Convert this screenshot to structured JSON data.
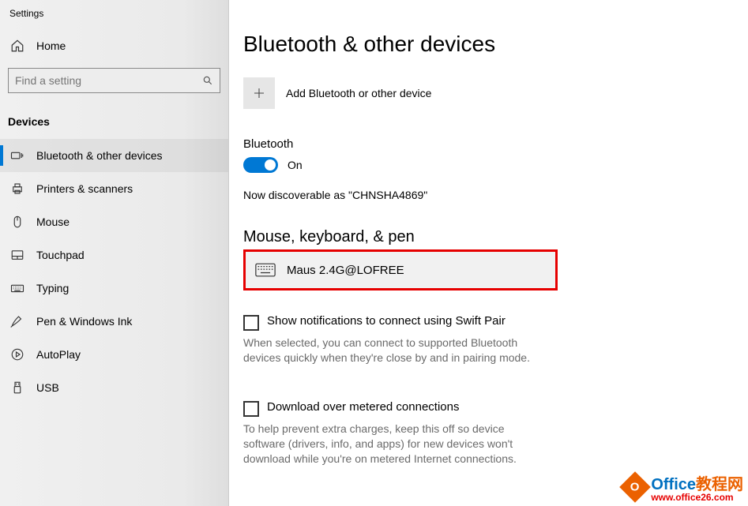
{
  "app_title": "Settings",
  "home": {
    "label": "Home"
  },
  "search": {
    "placeholder": "Find a setting"
  },
  "section_header": "Devices",
  "sidebar": {
    "items": [
      {
        "label": "Bluetooth & other devices"
      },
      {
        "label": "Printers & scanners"
      },
      {
        "label": "Mouse"
      },
      {
        "label": "Touchpad"
      },
      {
        "label": "Typing"
      },
      {
        "label": "Pen & Windows Ink"
      },
      {
        "label": "AutoPlay"
      },
      {
        "label": "USB"
      }
    ]
  },
  "main": {
    "title": "Bluetooth & other devices",
    "add_label": "Add Bluetooth or other device",
    "bt_label": "Bluetooth",
    "bt_state": "On",
    "discover_text": "Now discoverable as \"CHNSHA4869\"",
    "group_title": "Mouse, keyboard, & pen",
    "device_name": "Maus 2.4G@LOFREE",
    "swift_label": "Show notifications to connect using Swift Pair",
    "swift_hint": "When selected, you can connect to supported Bluetooth devices quickly when they're close by and in pairing mode.",
    "metered_label": "Download over metered connections",
    "metered_hint": "To help prevent extra charges, keep this off so device software (drivers, info, and apps) for new devices won't download while you're on metered Internet connections."
  },
  "watermark": {
    "brand_prefix": "Office",
    "brand_suffix": "教程网",
    "url": "www.office26.com"
  }
}
